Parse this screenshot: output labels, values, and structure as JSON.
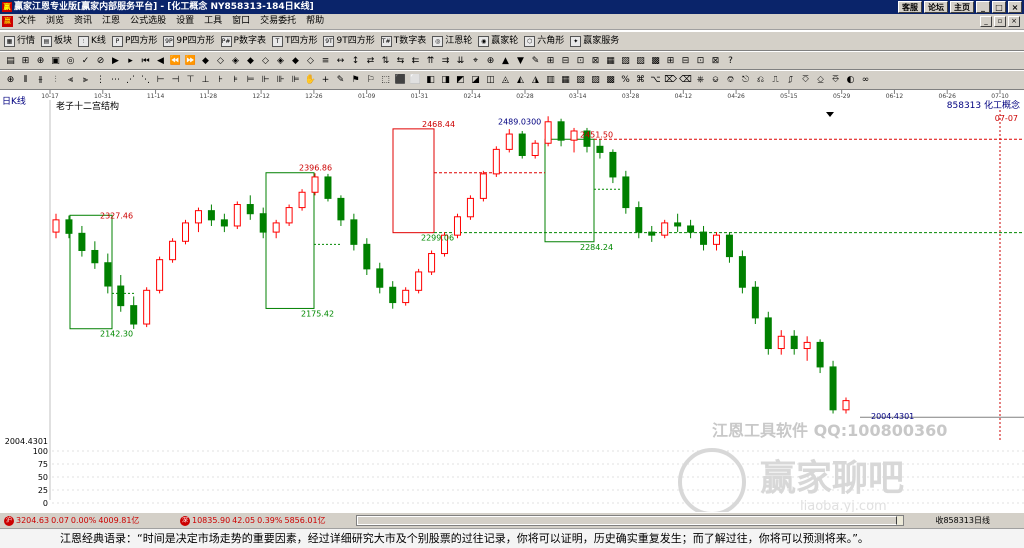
{
  "title_bar": {
    "icon_text": "赢",
    "text": "赢家江恩专业版[赢家内部服务平台] - [化工概念  NY858313-184日K线]",
    "buttons": [
      "客服",
      "论坛",
      "主页"
    ]
  },
  "menu": [
    "文件",
    "浏览",
    "资讯",
    "江恩",
    "公式选股",
    "设置",
    "工具",
    "窗口",
    "交易委托",
    "帮助"
  ],
  "toolbar1": [
    {
      "label": "行情",
      "icon": "grid-icon"
    },
    {
      "label": "板块",
      "icon": "sector-icon"
    },
    {
      "label": "K线",
      "icon": "kline-icon"
    },
    {
      "label": "P四方形",
      "icon": "p-square-icon"
    },
    {
      "label": "9P四方形",
      "icon": "9p-square-icon"
    },
    {
      "label": "P数字表",
      "icon": "p-table-icon"
    },
    {
      "label": "T四方形",
      "icon": "t-square-icon"
    },
    {
      "label": "9T四方形",
      "icon": "9t-square-icon"
    },
    {
      "label": "T数字表",
      "icon": "t-table-icon"
    },
    {
      "label": "江恩轮",
      "icon": "gann-wheel-icon"
    },
    {
      "label": "赢家轮",
      "icon": "winner-wheel-icon"
    },
    {
      "label": "六角形",
      "icon": "hexagon-icon"
    },
    {
      "label": "赢家服务",
      "icon": "service-icon"
    }
  ],
  "chart": {
    "period_label": "日K线",
    "indicator_name": "老子十二宫结构",
    "code_label": "858313 化工概念",
    "top_right_date": "07-07",
    "date_ticks": [
      "10-17",
      "10-31",
      "11-14",
      "11-28",
      "12-12",
      "12-26",
      "01-09",
      "01-31",
      "02-14",
      "02-28",
      "03-14",
      "03-28",
      "04-12",
      "04-26",
      "05-15",
      "05-29",
      "06-12",
      "06-26",
      "07-10"
    ],
    "annotations": [
      "2327.46",
      "2142.30",
      "2396.86",
      "2175.42",
      "2468.44",
      "2489.0300",
      "2299.06",
      "2451.50",
      "2284.24",
      "2004.4301"
    ],
    "left_scale": [
      "2004.4301",
      "100",
      "75",
      "50",
      "25",
      "0"
    ],
    "watermark_line1": "江恩工具软件    QQ:100800360",
    "watermark_line2": "赢家聊吧",
    "watermark_line3": "liaoba.yj.com"
  },
  "chart_data": {
    "type": "candlestick",
    "title": "化工概念",
    "x_ticks": [
      "10-17",
      "10-31",
      "11-14",
      "11-28",
      "12-12",
      "12-26",
      "01-09",
      "01-31",
      "02-14",
      "02-28",
      "03-14",
      "03-28",
      "04-12",
      "04-26",
      "05-15",
      "05-29",
      "06-12",
      "06-26",
      "07-10"
    ],
    "ohlc": [
      [
        2300,
        2330,
        2290,
        2320
      ],
      [
        2320,
        2327,
        2290,
        2298
      ],
      [
        2298,
        2310,
        2260,
        2270
      ],
      [
        2270,
        2285,
        2240,
        2250
      ],
      [
        2250,
        2265,
        2200,
        2212
      ],
      [
        2212,
        2230,
        2170,
        2180
      ],
      [
        2180,
        2195,
        2142,
        2150
      ],
      [
        2150,
        2210,
        2145,
        2205
      ],
      [
        2205,
        2260,
        2200,
        2255
      ],
      [
        2255,
        2290,
        2250,
        2285
      ],
      [
        2285,
        2320,
        2280,
        2315
      ],
      [
        2315,
        2340,
        2300,
        2335
      ],
      [
        2335,
        2345,
        2310,
        2320
      ],
      [
        2320,
        2330,
        2300,
        2310
      ],
      [
        2310,
        2350,
        2305,
        2345
      ],
      [
        2345,
        2360,
        2320,
        2330
      ],
      [
        2330,
        2340,
        2290,
        2300
      ],
      [
        2300,
        2320,
        2290,
        2315
      ],
      [
        2315,
        2345,
        2310,
        2340
      ],
      [
        2340,
        2370,
        2335,
        2365
      ],
      [
        2365,
        2396,
        2360,
        2390
      ],
      [
        2390,
        2395,
        2350,
        2355
      ],
      [
        2355,
        2360,
        2310,
        2320
      ],
      [
        2320,
        2330,
        2270,
        2280
      ],
      [
        2280,
        2290,
        2230,
        2240
      ],
      [
        2240,
        2250,
        2200,
        2210
      ],
      [
        2210,
        2220,
        2175,
        2185
      ],
      [
        2185,
        2210,
        2180,
        2205
      ],
      [
        2205,
        2240,
        2200,
        2235
      ],
      [
        2235,
        2270,
        2230,
        2265
      ],
      [
        2265,
        2300,
        2260,
        2295
      ],
      [
        2295,
        2330,
        2290,
        2325
      ],
      [
        2325,
        2360,
        2320,
        2355
      ],
      [
        2355,
        2400,
        2350,
        2395
      ],
      [
        2395,
        2440,
        2390,
        2435
      ],
      [
        2435,
        2468,
        2430,
        2460
      ],
      [
        2460,
        2465,
        2420,
        2425
      ],
      [
        2425,
        2450,
        2420,
        2445
      ],
      [
        2445,
        2489,
        2440,
        2480
      ],
      [
        2480,
        2485,
        2440,
        2450
      ],
      [
        2450,
        2470,
        2430,
        2465
      ],
      [
        2465,
        2470,
        2430,
        2440
      ],
      [
        2440,
        2451,
        2420,
        2430
      ],
      [
        2430,
        2435,
        2380,
        2390
      ],
      [
        2390,
        2400,
        2330,
        2340
      ],
      [
        2340,
        2350,
        2290,
        2300
      ],
      [
        2300,
        2310,
        2284,
        2295
      ],
      [
        2295,
        2320,
        2290,
        2315
      ],
      [
        2315,
        2330,
        2300,
        2310
      ],
      [
        2310,
        2320,
        2290,
        2300
      ],
      [
        2300,
        2310,
        2270,
        2280
      ],
      [
        2280,
        2300,
        2270,
        2295
      ],
      [
        2295,
        2300,
        2250,
        2260
      ],
      [
        2260,
        2270,
        2200,
        2210
      ],
      [
        2210,
        2220,
        2150,
        2160
      ],
      [
        2160,
        2170,
        2100,
        2110
      ],
      [
        2110,
        2140,
        2100,
        2130
      ],
      [
        2130,
        2140,
        2100,
        2110
      ],
      [
        2110,
        2130,
        2090,
        2120
      ],
      [
        2120,
        2125,
        2070,
        2080
      ],
      [
        2080,
        2090,
        2004,
        2010
      ],
      [
        2010,
        2030,
        2004,
        2025
      ]
    ],
    "ylim": [
      2004.4301,
      2489.03
    ]
  },
  "status": {
    "sh": {
      "index": "3204.63",
      "chg": "0.07",
      "pct": "0.00%",
      "amount": "4009.81亿"
    },
    "sz": {
      "index": "10835.90",
      "chg": "42.05",
      "pct": "0.39%",
      "amount": "5856.01亿"
    },
    "right": "收858313日线"
  },
  "quote": "江恩经典语录：“时间是决定市场走势的重要因素，经过详细研究大市及个别股票的过往记录，你将可以证明，历史确实重复发生；而了解过往，你将可以预测将来。”。",
  "colors": {
    "up": "#ff0000",
    "down": "#008000",
    "box_red": "#e00000",
    "box_green": "#008000",
    "navy": "#000080"
  }
}
